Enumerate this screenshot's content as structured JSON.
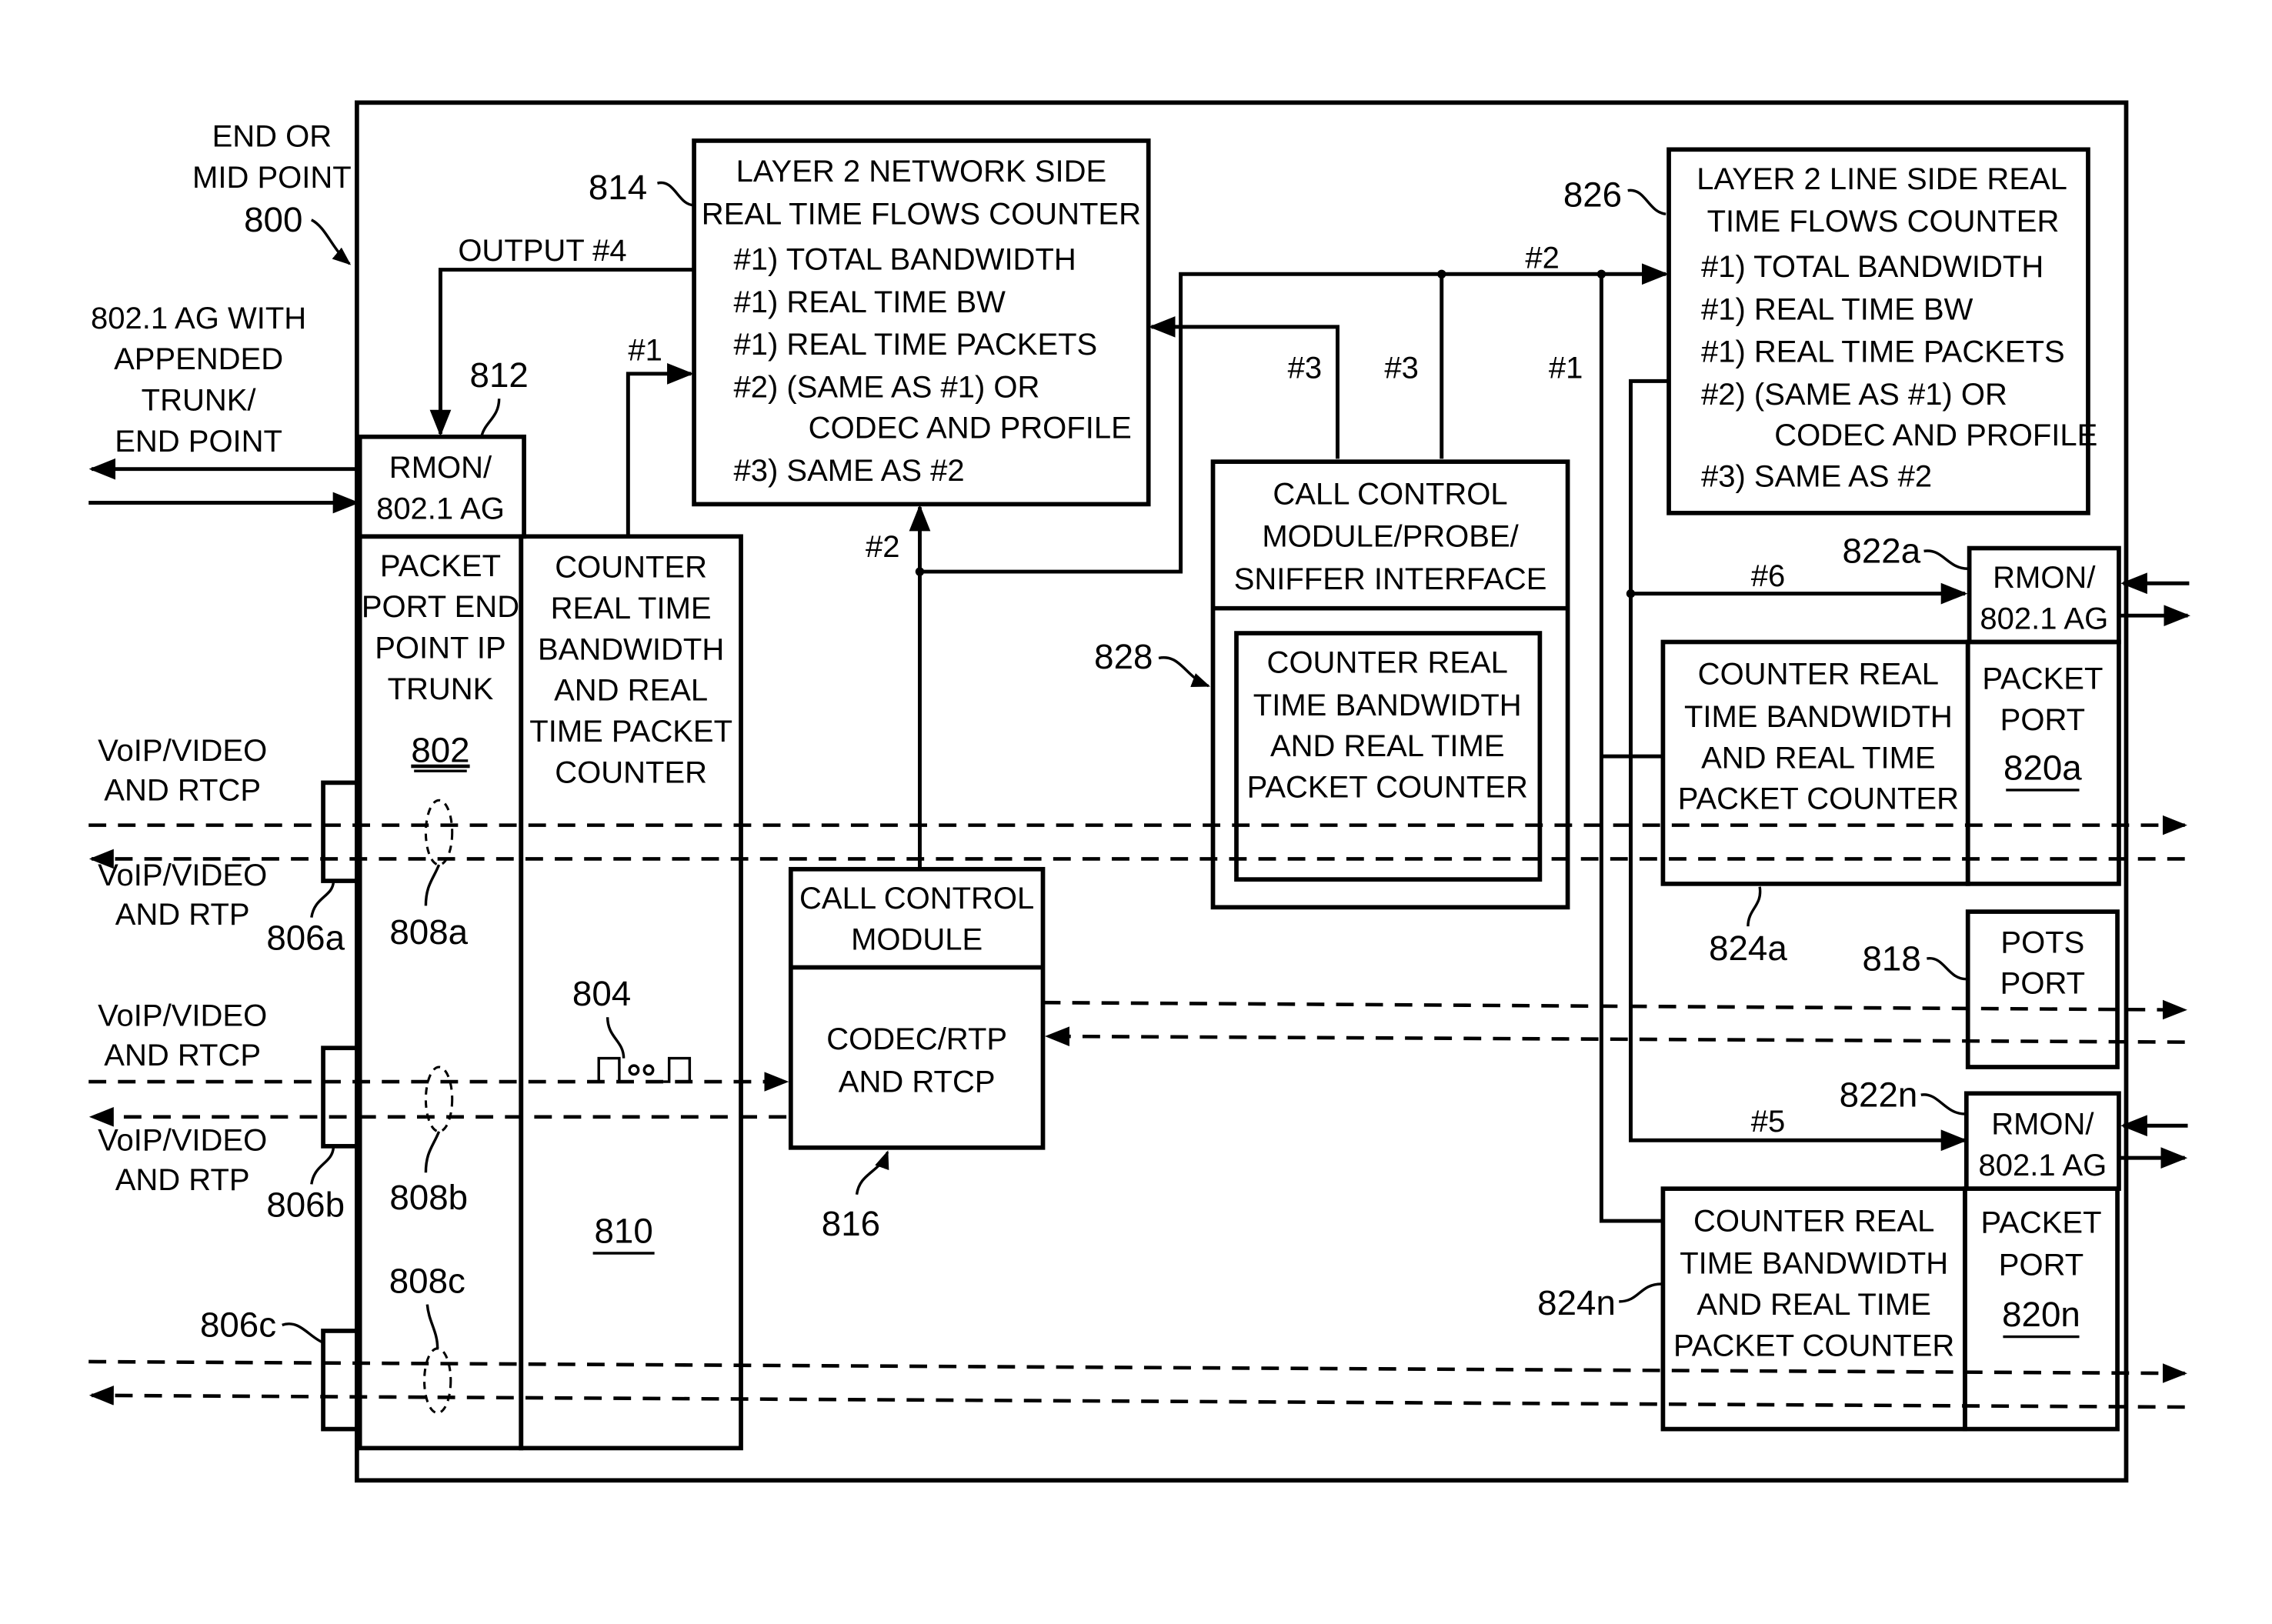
{
  "figure": {
    "end_point_label": [
      "END OR",
      "MID POINT"
    ],
    "end_point_ref": "800",
    "trunk_label": [
      "802.1 AG WITH",
      "APPENDED",
      "TRUNK/",
      "END POINT"
    ],
    "output4_label": "OUTPUT #4"
  },
  "blocks": {
    "rmon_812": {
      "ref": "812",
      "lines": [
        "RMON/",
        "802.1 AG"
      ]
    },
    "packet_port_802": {
      "ref": "802",
      "lines": [
        "PACKET",
        "PORT END",
        "POINT IP",
        "TRUNK"
      ]
    },
    "counter_810": {
      "ref": "810",
      "lines": [
        "COUNTER",
        "REAL TIME",
        "BANDWIDTH",
        "AND REAL",
        "TIME PACKET",
        "COUNTER"
      ]
    },
    "network_counter_814": {
      "ref": "814",
      "lines": [
        "LAYER 2 NETWORK SIDE",
        "REAL TIME FLOWS COUNTER",
        "#1) TOTAL BANDWIDTH",
        "#1) REAL TIME BW",
        "#1) REAL TIME PACKETS",
        "#2) (SAME AS #1) OR",
        "CODEC AND PROFILE",
        "#3) SAME AS #2"
      ]
    },
    "line_counter_826": {
      "ref": "826",
      "lines": [
        "LAYER 2 LINE SIDE REAL",
        "TIME FLOWS COUNTER",
        "#1) TOTAL BANDWIDTH",
        "#1) REAL TIME BW",
        "#1) REAL TIME PACKETS",
        "#2) (SAME AS #1) OR",
        "CODEC AND PROFILE",
        "#3) SAME AS #2"
      ]
    },
    "call_control_816": {
      "ref": "816",
      "title": [
        "CALL CONTROL",
        "MODULE"
      ],
      "body": [
        "CODEC/RTP",
        "AND RTCP"
      ]
    },
    "probe_828": {
      "ref": "828",
      "title": [
        "CALL CONTROL",
        "MODULE/PROBE/",
        "SNIFFER INTERFACE"
      ],
      "inner": [
        "COUNTER REAL",
        "TIME BANDWIDTH",
        "AND REAL TIME",
        "PACKET COUNTER"
      ]
    },
    "rmon_822a": {
      "ref": "822a",
      "lines": [
        "RMON/",
        "802.1 AG"
      ]
    },
    "counter_824a": {
      "ref": "824a",
      "lines": [
        "COUNTER REAL",
        "TIME BANDWIDTH",
        "AND REAL TIME",
        "PACKET COUNTER"
      ]
    },
    "packet_port_820a": {
      "ref": "820a",
      "lines": [
        "PACKET",
        "PORT"
      ]
    },
    "pots_818": {
      "ref": "818",
      "lines": [
        "POTS",
        "PORT"
      ]
    },
    "rmon_822n": {
      "ref": "822n",
      "lines": [
        "RMON/",
        "802.1 AG"
      ]
    },
    "counter_824n": {
      "ref": "824n",
      "lines": [
        "COUNTER REAL",
        "TIME BANDWIDTH",
        "AND REAL TIME",
        "PACKET COUNTER"
      ]
    },
    "packet_port_820n": {
      "ref": "820n",
      "lines": [
        "PACKET",
        "PORT"
      ]
    }
  },
  "flows": {
    "voip_rtcp": [
      "VoIP/VIDEO",
      "AND RTCP"
    ],
    "voip_rtp": [
      "VoIP/VIDEO",
      "AND RTP"
    ],
    "ports": [
      "806a",
      "806b",
      "806c"
    ],
    "taps": [
      "808a",
      "808b",
      "808c"
    ],
    "switch_ref": "804"
  },
  "connections": {
    "c1_left": "#1",
    "c2_mid": "#2",
    "c2_top": "#2",
    "c3_a": "#3",
    "c3_b": "#3",
    "c1_right": "#1",
    "c6": "#6",
    "c5": "#5"
  }
}
